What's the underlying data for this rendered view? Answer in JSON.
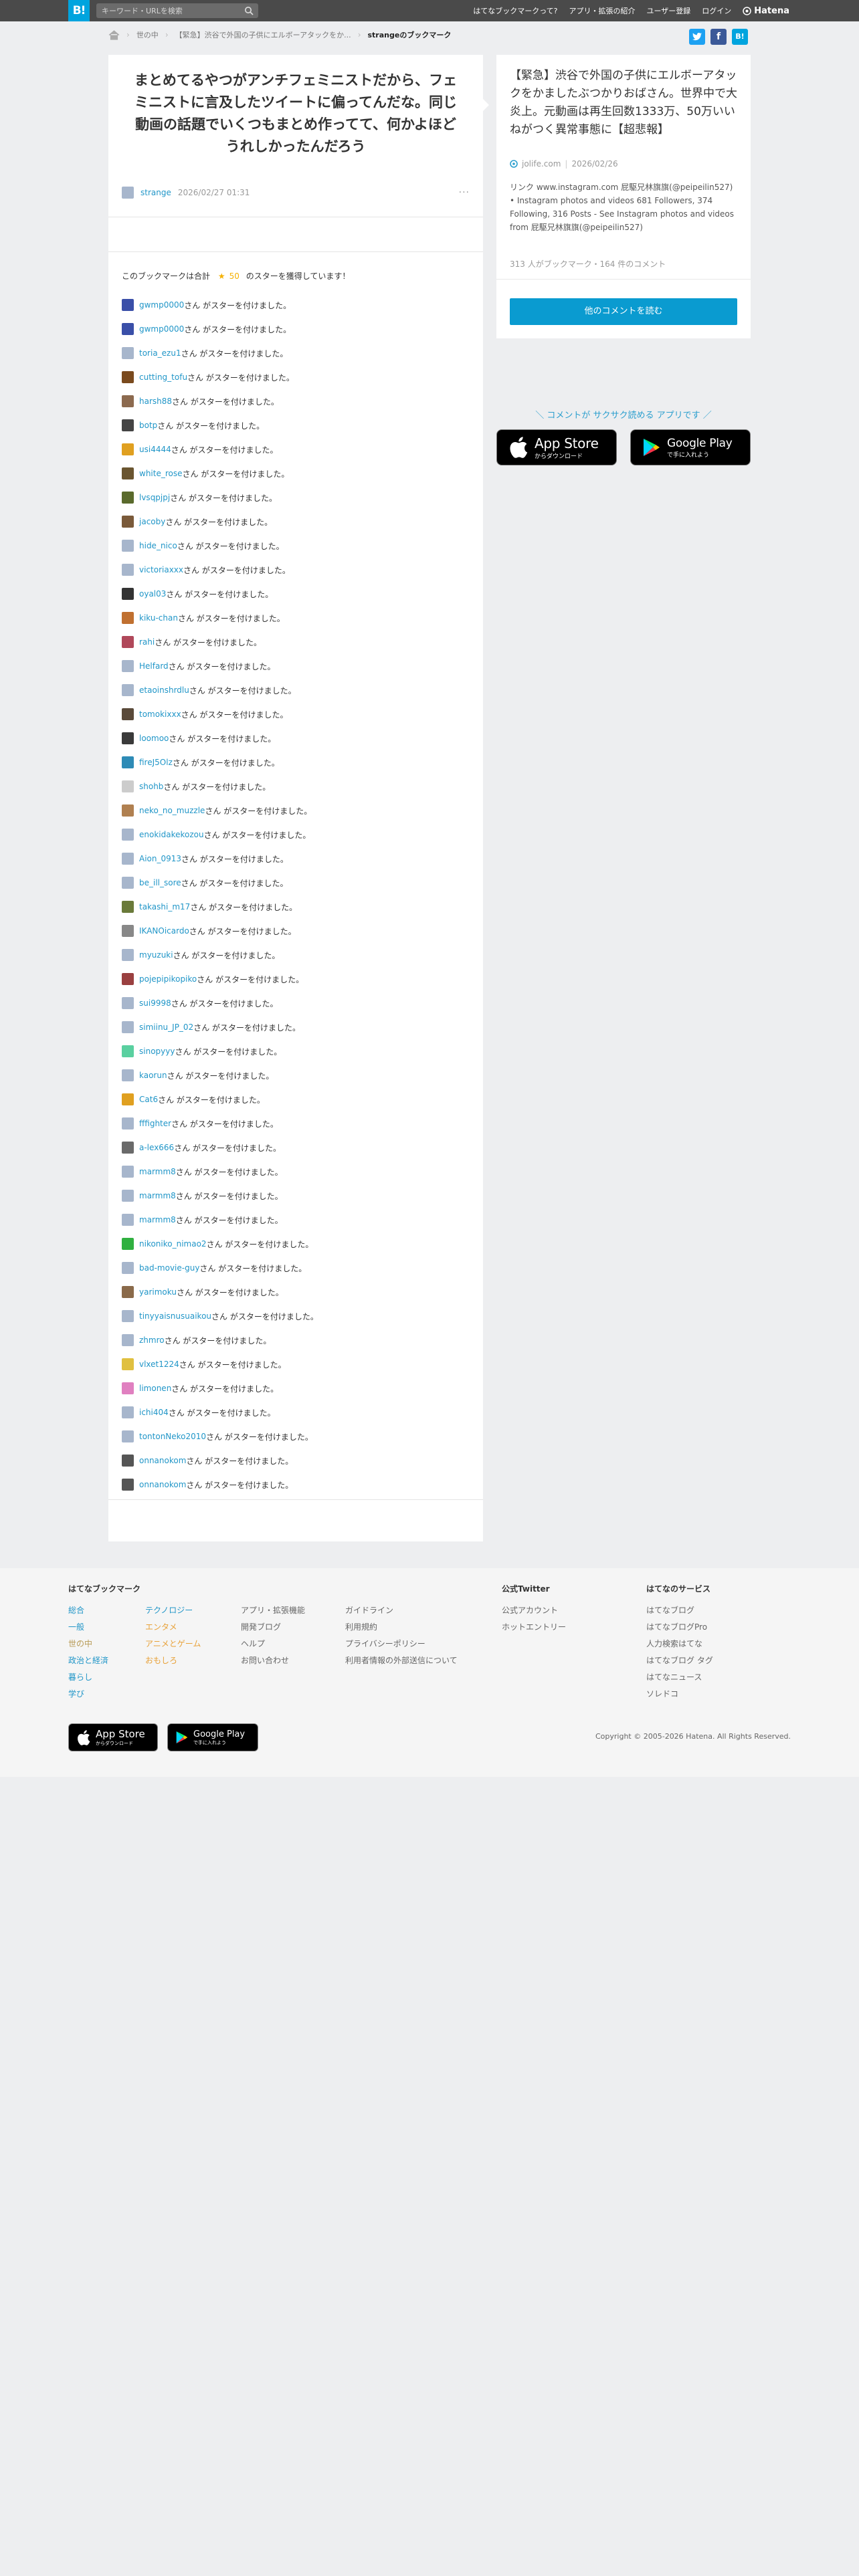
{
  "topbar": {
    "logo": "B!",
    "search_placeholder": "キーワード・URLを検索",
    "nav": [
      "はてなブックマークって?",
      "アプリ・拡張の紹介",
      "ユーザー登録",
      "ログイン"
    ],
    "brand": "Hatena"
  },
  "breadcrumb": {
    "category": "世の中",
    "entry": "【緊急】渋谷で外国の子供にエルボーアタックをか...",
    "current": "strangeのブックマーク"
  },
  "share": {
    "twitter": "t",
    "facebook": "f",
    "hatena": "B!"
  },
  "entry": {
    "comment": "まとめてるやつがアンチフェミニストだから、フェミニストに言及したツイートに偏ってんだな。同じ動画の話題でいくつもまとめ作ってて、何かよほどうれしかったんだろう",
    "user": "strange",
    "date": "2026/02/27 01:31",
    "more": "···",
    "stars_prefix": "このブックマークは合計",
    "stars_count": "50",
    "stars_suffix": "のスターを獲得しています！"
  },
  "star_suffix": "さん がスターを付けました。",
  "star_users": [
    {
      "name": "gwmp0000",
      "color": "#3a4fa8"
    },
    {
      "name": "gwmp0000",
      "color": "#3a4fa8"
    },
    {
      "name": "toria_ezu1",
      "color": "#a7b6cc"
    },
    {
      "name": "cutting_tofu",
      "color": "#7a4a1e"
    },
    {
      "name": "harsh88",
      "color": "#8c6a4f"
    },
    {
      "name": "botp",
      "color": "#444444"
    },
    {
      "name": "usi4444",
      "color": "#e0a020"
    },
    {
      "name": "white_rose",
      "color": "#6a5530"
    },
    {
      "name": "lvsqpjpj",
      "color": "#5a6a2c"
    },
    {
      "name": "jacoby",
      "color": "#7a5a3a"
    },
    {
      "name": "hide_nico",
      "color": "#a7b6cc"
    },
    {
      "name": "victoriaxxx",
      "color": "#a7b6cc"
    },
    {
      "name": "oyal03",
      "color": "#333333"
    },
    {
      "name": "kiku-chan",
      "color": "#c07030"
    },
    {
      "name": "rahi",
      "color": "#b0485a"
    },
    {
      "name": "Helfard",
      "color": "#a7b6cc"
    },
    {
      "name": "etaoinshrdlu",
      "color": "#a7b6cc"
    },
    {
      "name": "tomokixxx",
      "color": "#5a4a3a"
    },
    {
      "name": "loomoo",
      "color": "#3a3a3a"
    },
    {
      "name": "fireJ5Olz",
      "color": "#2e8bb6"
    },
    {
      "name": "shohb",
      "color": "#cccccc"
    },
    {
      "name": "neko_no_muzzle",
      "color": "#b08050"
    },
    {
      "name": "enokidakekozou",
      "color": "#a7b6cc"
    },
    {
      "name": "Aion_0913",
      "color": "#a7b6cc"
    },
    {
      "name": "be_ill_sore",
      "color": "#a7b6cc"
    },
    {
      "name": "takashi_m17",
      "color": "#6a7a3a"
    },
    {
      "name": "IKANOicardo",
      "color": "#888888"
    },
    {
      "name": "myuzuki",
      "color": "#a7b6cc"
    },
    {
      "name": "pojepipikopiko",
      "color": "#9a4040"
    },
    {
      "name": "sui9998",
      "color": "#a7b6cc"
    },
    {
      "name": "simiinu_JP_02",
      "color": "#a7b6cc"
    },
    {
      "name": "sinopyyy",
      "color": "#5ad0a0"
    },
    {
      "name": "kaorun",
      "color": "#a7b6cc"
    },
    {
      "name": "Cat6",
      "color": "#e0a020"
    },
    {
      "name": "fffighter",
      "color": "#a7b6cc"
    },
    {
      "name": "a-lex666",
      "color": "#6a6a6a"
    },
    {
      "name": "marmm8",
      "color": "#a7b6cc"
    },
    {
      "name": "marmm8",
      "color": "#a7b6cc"
    },
    {
      "name": "marmm8",
      "color": "#a7b6cc"
    },
    {
      "name": "nikoniko_nimao2",
      "color": "#30b040"
    },
    {
      "name": "bad-movie-guy",
      "color": "#a7b6cc"
    },
    {
      "name": "yarimoku",
      "color": "#8a6a4a"
    },
    {
      "name": "tinyyaisnusuaikou",
      "color": "#a7b6cc"
    },
    {
      "name": "zhmro",
      "color": "#a7b6cc"
    },
    {
      "name": "vlxet1224",
      "color": "#e0c040"
    },
    {
      "name": "limonen",
      "color": "#e080c0"
    },
    {
      "name": "ichi404",
      "color": "#a7b6cc"
    },
    {
      "name": "tontonNeko2010",
      "color": "#a7b6cc"
    },
    {
      "name": "onnanokom",
      "color": "#555555"
    },
    {
      "name": "onnanokom",
      "color": "#555555"
    }
  ],
  "side": {
    "title": "【緊急】渋谷で外国の子供にエルボーアタックをかましたぶつかりおばさん。世界中で大炎上。元動画は再生回数1333万、50万いいねがつく異常事態に【超悲報】",
    "source": "jolife.com",
    "date": "2026/02/26",
    "description": "リンク www.instagram.com 屁駆兄林旗旗(@peipeilin527) • Instagram photos and videos 681 Followers, 374 Following, 316 Posts - See Instagram photos and videos from 屁駆兄林旗旗(@peipeilin527)",
    "stats": "313 人がブックマーク・164 件のコメント",
    "read_button": "他のコメントを読む"
  },
  "promo": {
    "text": "＼ コメントが サクサク読める アプリです ／",
    "appstore_small": "からダウンロード",
    "appstore_big": "App Store",
    "googleplay_small": "で手に入れよう",
    "googleplay_big": "Google Play"
  },
  "footer": {
    "col1_title": "はてなブックマーク",
    "col1a": [
      "総合",
      "一般",
      "世の中",
      "政治と経済",
      "暮らし",
      "学び"
    ],
    "col1b": [
      "テクノロジー",
      "エンタメ",
      "アニメとゲーム",
      "おもしろ"
    ],
    "col1c": [
      "アプリ・拡張機能",
      "開発ブログ",
      "ヘルプ",
      "お問い合わせ"
    ],
    "col1d": [
      "ガイドライン",
      "利用規約",
      "プライバシーポリシー",
      "利用者情報の外部送信について"
    ],
    "col2_title": "公式Twitter",
    "col2": [
      "公式アカウント",
      "ホットエントリー"
    ],
    "col3_title": "はてなのサービス",
    "col3": [
      "はてなブログ",
      "はてなブログPro",
      "人力検索はてな",
      "はてなブログ タグ",
      "はてなニュース",
      "ソレドコ"
    ],
    "copyright": "Copyright © 2005-2026 Hatena. All Rights Reserved.",
    "appstore_small": "からダウンロード",
    "appstore_big": "App Store",
    "googleplay_small": "で手に入れよう",
    "googleplay_big": "Google Play"
  },
  "colors": {
    "accent": "#00a4de",
    "link": "#2196c8",
    "topbar": "#4a4a4a",
    "star": "#f5b100",
    "footer_link_blue": "#2196c8",
    "footer_link_orange": "#e8a23a",
    "footer_link_brown": "#b79a55"
  },
  "icons": [
    "search-icon",
    "home-icon",
    "twitter-icon",
    "facebook-icon",
    "hatena-bookmark-icon",
    "star-icon",
    "apple-icon",
    "google-play-icon",
    "hatena-brand-icon"
  ]
}
